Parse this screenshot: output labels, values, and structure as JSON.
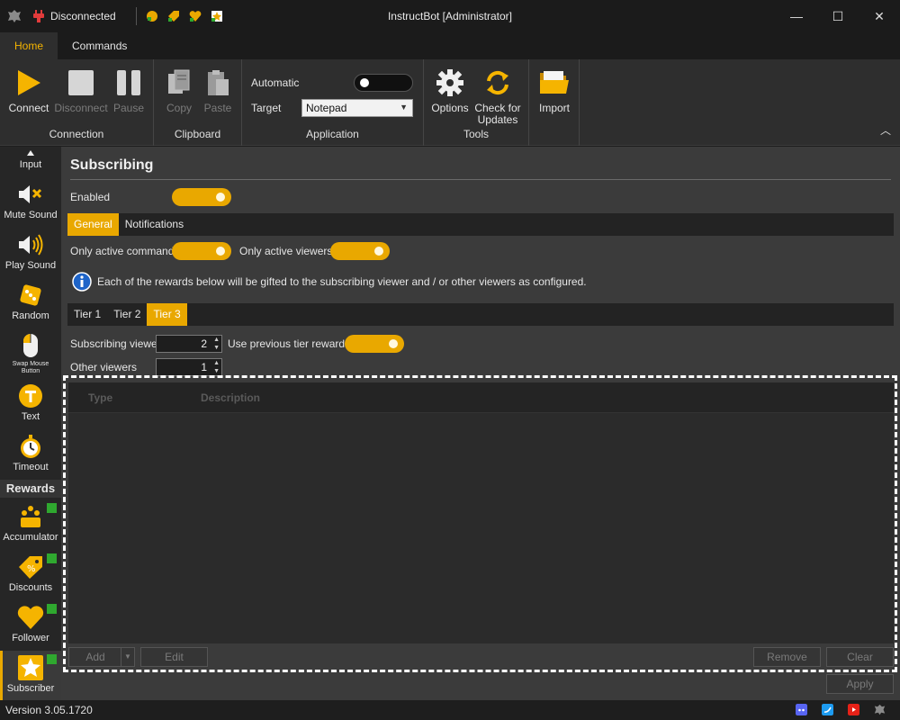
{
  "window": {
    "title": "InstructBot [Administrator]",
    "status": "Disconnected",
    "controls": {
      "minimize": "—",
      "maximize": "☐",
      "close": "✕"
    }
  },
  "ribbon_tabs": [
    {
      "label": "Home",
      "active": true
    },
    {
      "label": "Commands",
      "active": false
    }
  ],
  "ribbon": {
    "connection": {
      "label": "Connection",
      "connect": "Connect",
      "disconnect": "Disconnect",
      "pause": "Pause"
    },
    "clipboard": {
      "label": "Clipboard",
      "copy": "Copy",
      "paste": "Paste"
    },
    "application": {
      "label": "Application",
      "automatic": "Automatic",
      "target": "Target",
      "target_value": "Notepad"
    },
    "tools": {
      "label": "Tools",
      "options": "Options",
      "check_updates_1": "Check for",
      "check_updates_2": "Updates"
    },
    "import": "Import"
  },
  "sidebar": {
    "items": [
      {
        "label": "Input"
      },
      {
        "label": "Mute Sound"
      },
      {
        "label": "Play Sound"
      },
      {
        "label": "Random"
      },
      {
        "label_1": "Swap Mouse",
        "label_2": "Button"
      },
      {
        "label": "Text"
      },
      {
        "label": "Timeout"
      }
    ],
    "section": "Rewards",
    "rewards": [
      {
        "label": "Accumulator"
      },
      {
        "label": "Discounts"
      },
      {
        "label": "Follower"
      },
      {
        "label": "Subscriber"
      }
    ]
  },
  "main": {
    "title": "Subscribing",
    "enabled_label": "Enabled",
    "tabs": [
      "General",
      "Notifications"
    ],
    "only_active_commands": "Only active commands",
    "only_active_viewers": "Only active viewers",
    "info_text": "Each of the rewards below will be gifted to the subscribing viewer and / or other viewers as configured.",
    "tiers": [
      "Tier 1",
      "Tier 2",
      "Tier 3"
    ],
    "subscribing_viewer_label": "Subscribing viewer",
    "subscribing_viewer_value": "2",
    "use_previous_label": "Use previous tier rewards",
    "other_viewers_label": "Other viewers",
    "other_viewers_value": "1",
    "grid": {
      "col_type": "Type",
      "col_description": "Description"
    },
    "buttons": {
      "add": "Add",
      "edit": "Edit",
      "remove": "Remove",
      "clear": "Clear",
      "apply": "Apply"
    }
  },
  "statusbar": {
    "version": "Version 3.05.1720"
  },
  "colors": {
    "accent": "#e9a800",
    "badge": "#2fa82f"
  }
}
